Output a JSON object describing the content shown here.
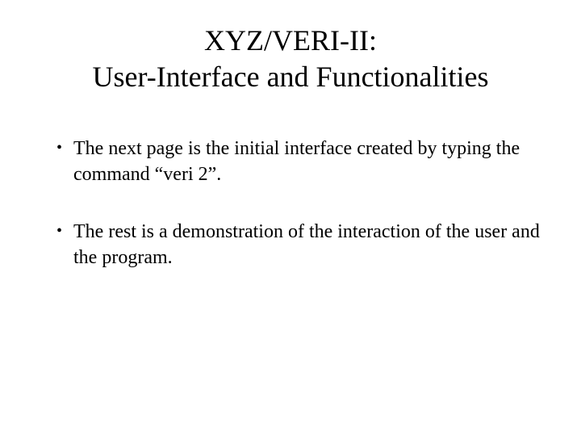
{
  "slide": {
    "title_line1": "XYZ/VERI-II:",
    "title_line2": "User-Interface and Functionalities",
    "bullets": [
      "The next page is the initial interface created by typing the command “veri 2”.",
      "The rest is a demonstration of the interaction of the user and the program."
    ]
  }
}
